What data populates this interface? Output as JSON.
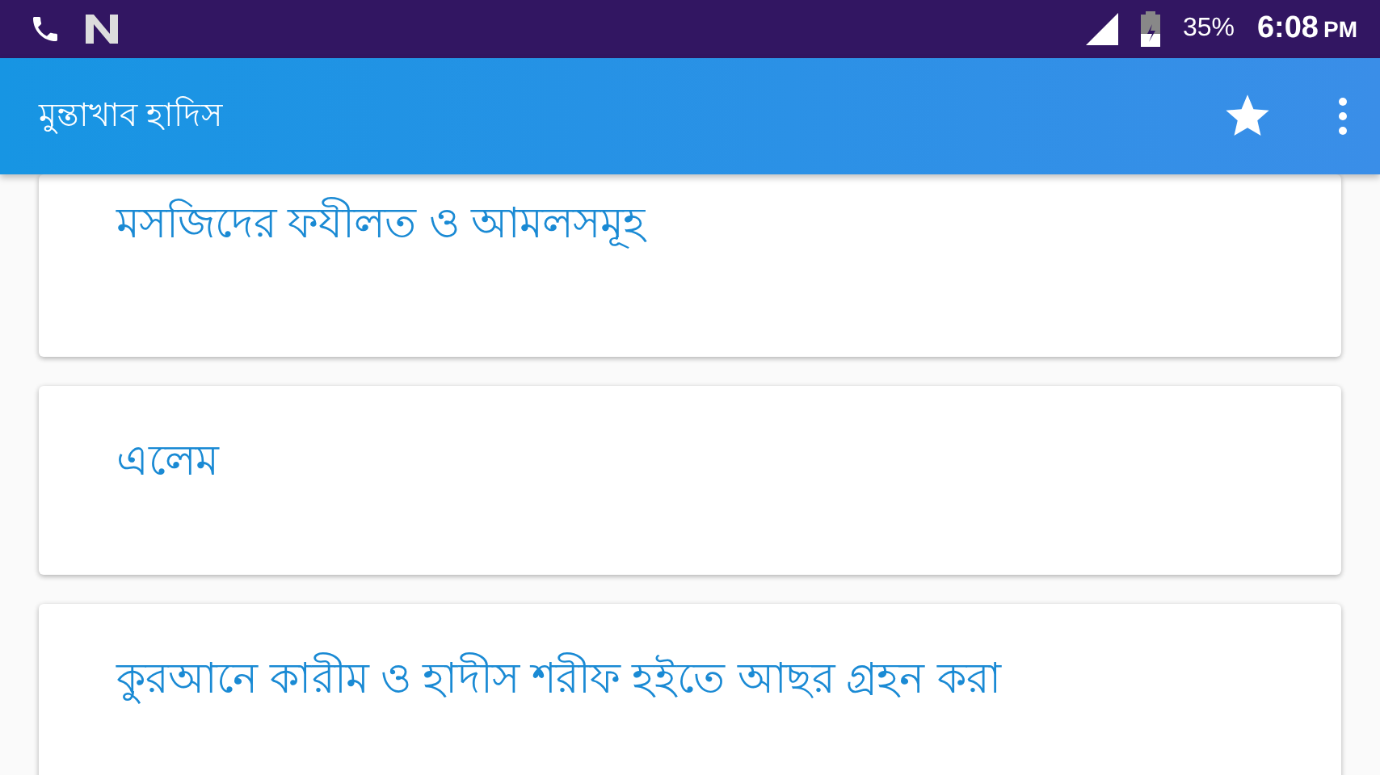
{
  "status_bar": {
    "battery": "35%",
    "time": "6:08",
    "meridiem": "PM"
  },
  "app_bar": {
    "title": "মুন্তাখাব হাদিস"
  },
  "items": [
    {
      "title": "মসজিদের ফযীলত ও আমলসমূহ"
    },
    {
      "title": "এলেম"
    },
    {
      "title": "কুরআনে কারীম ও হাদীস শরীফ হইতে আছর গ্রহন করা"
    }
  ]
}
